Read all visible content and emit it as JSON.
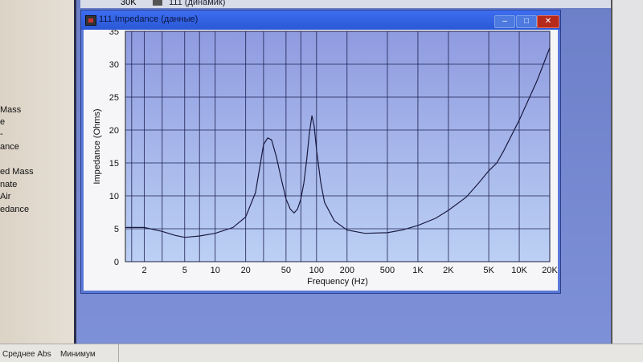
{
  "left_panel": {
    "labels": [
      "Mass",
      "e",
      "-",
      "ance",
      "ed Mass",
      "nate",
      "Air",
      "edance"
    ]
  },
  "top_row": {
    "value": "30K",
    "item": "111 (динамик)"
  },
  "window": {
    "title": "111.Impedance (данные)",
    "minimize": "–",
    "maximize": "□",
    "close": "✕"
  },
  "status_bar": {
    "col1": "Среднее Abs",
    "col2": "Минимум"
  },
  "colors": {
    "plot_bg_top": "#8f9be0",
    "plot_bg_bottom": "#bcd0f4",
    "curve": "#1a1a40",
    "title_bar": "#2f62e4"
  },
  "chart_data": {
    "type": "line",
    "title": "",
    "xlabel": "Frequency (Hz)",
    "ylabel": "Impedance (Ohms)",
    "xscale": "log",
    "xlim": [
      1.3,
      20000
    ],
    "ylim": [
      0,
      35
    ],
    "grid": true,
    "xticks": [
      {
        "v": 2,
        "label": "2"
      },
      {
        "v": 5,
        "label": "5"
      },
      {
        "v": 10,
        "label": "10"
      },
      {
        "v": 20,
        "label": "20"
      },
      {
        "v": 50,
        "label": "50"
      },
      {
        "v": 100,
        "label": "100"
      },
      {
        "v": 200,
        "label": "200"
      },
      {
        "v": 500,
        "label": "500"
      },
      {
        "v": 1000,
        "label": "1K"
      },
      {
        "v": 2000,
        "label": "2K"
      },
      {
        "v": 5000,
        "label": "5K"
      },
      {
        "v": 10000,
        "label": "10K"
      },
      {
        "v": 20000,
        "label": "20K"
      }
    ],
    "xgrid": [
      1.5,
      2,
      3,
      5,
      7,
      10,
      20,
      30,
      50,
      70,
      100,
      200,
      500,
      1000,
      2000,
      5000,
      10000,
      20000
    ],
    "yticks": [
      0,
      5,
      10,
      15,
      20,
      25,
      30,
      35
    ],
    "series": [
      {
        "name": "Impedance",
        "x": [
          1.3,
          2,
          3,
          4,
          5,
          6,
          7,
          10,
          15,
          20,
          25,
          28,
          30,
          33,
          36,
          40,
          45,
          50,
          55,
          60,
          65,
          70,
          75,
          80,
          85,
          90,
          95,
          100,
          110,
          120,
          150,
          200,
          300,
          500,
          700,
          1000,
          1500,
          2000,
          3000,
          4000,
          5000,
          6000,
          7000,
          10000,
          15000,
          20000
        ],
        "y": [
          5.2,
          5.2,
          4.6,
          4.0,
          3.7,
          3.8,
          3.9,
          4.3,
          5.2,
          6.8,
          10.5,
          15.0,
          17.8,
          18.8,
          18.5,
          16.0,
          12.5,
          9.5,
          8.0,
          7.4,
          8.0,
          9.5,
          12.0,
          15.5,
          19.5,
          22.2,
          20.5,
          17.0,
          12.0,
          9.0,
          6.2,
          4.8,
          4.3,
          4.4,
          4.8,
          5.5,
          6.6,
          7.8,
          9.8,
          12.0,
          13.8,
          15.0,
          16.8,
          21.5,
          27.5,
          32.5
        ]
      }
    ]
  }
}
